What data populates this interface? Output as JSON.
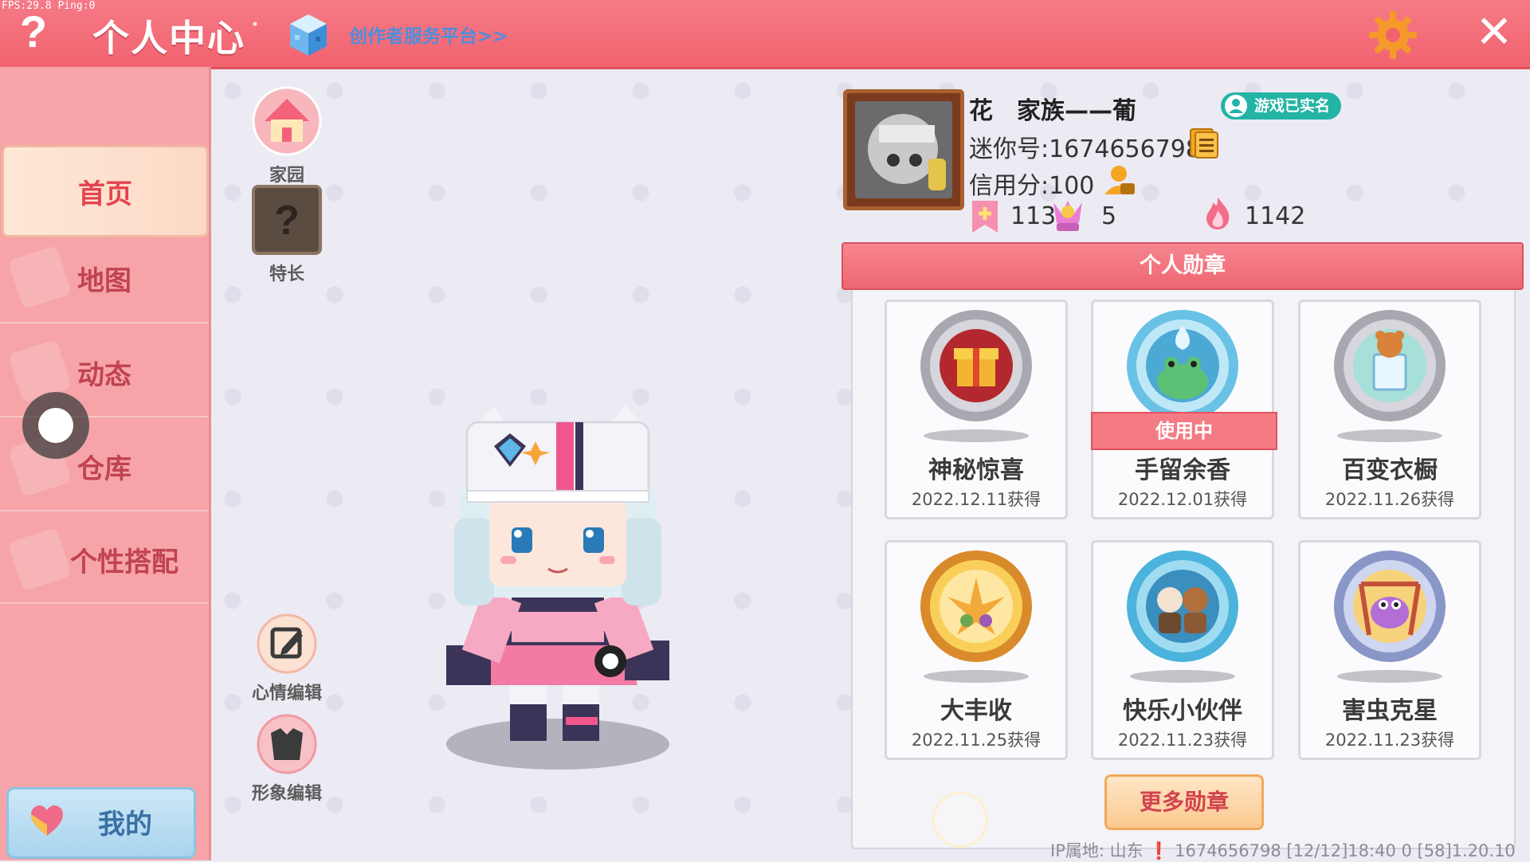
{
  "debug": {
    "fps_text": "FPS:29.8  Ping:0"
  },
  "header": {
    "title": "个人中心",
    "creator_link": "创作者服务平台>>",
    "help_symbol": "?",
    "close_symbol": "✕",
    "accent_color": "#f1636f"
  },
  "sidebar": {
    "items": [
      {
        "label": "首页",
        "active": true
      },
      {
        "label": "地图",
        "active": false
      },
      {
        "label": "动态",
        "active": false
      },
      {
        "label": "仓库",
        "active": false
      },
      {
        "label": "个性搭配",
        "active": false
      }
    ],
    "me_button": "我的"
  },
  "tools": {
    "home": "家园",
    "skill": "特长",
    "mood_edit": "心情编辑",
    "avatar_edit": "形象编辑"
  },
  "profile": {
    "name": "花　家族——葡",
    "verified": "游戏已实名",
    "mini_id": "迷你号:1674656798",
    "credit": "信用分:100",
    "stats": {
      "likes": "113",
      "fans": "5",
      "heat": "1142"
    }
  },
  "medals": {
    "header": "个人勋章",
    "in_use_label": "使用中",
    "items": [
      {
        "name": "神秘惊喜",
        "date": "2022.12.11获得",
        "in_use": false
      },
      {
        "name": "手留余香",
        "date": "2022.12.01获得",
        "in_use": true
      },
      {
        "name": "百变衣橱",
        "date": "2022.11.26获得",
        "in_use": false
      },
      {
        "name": "大丰收",
        "date": "2022.11.25获得",
        "in_use": false
      },
      {
        "name": "快乐小伙伴",
        "date": "2022.11.23获得",
        "in_use": false
      },
      {
        "name": "害虫克星",
        "date": "2022.11.23获得",
        "in_use": false
      }
    ],
    "more_button": "更多勋章"
  },
  "footer": {
    "info": "IP属地: 山东 ❗   1674656798   [12/12]18:40 0  [58]1.20.10"
  }
}
